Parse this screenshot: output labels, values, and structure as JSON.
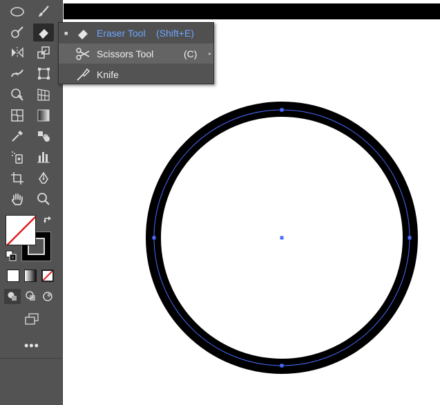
{
  "menu": {
    "items": [
      {
        "label": "Eraser Tool",
        "shortcut": "(Shift+E)",
        "icon": "eraser-icon",
        "selected": true
      },
      {
        "label": "Scissors Tool",
        "shortcut": "(C)",
        "icon": "scissors-icon"
      },
      {
        "label": "Knife",
        "shortcut": "",
        "icon": "knife-icon"
      }
    ]
  },
  "toolbar": {
    "tools": [
      "ellipse-icon",
      "paintbrush-icon",
      "shaper-icon",
      "eraser-icon",
      "reflect-icon",
      "scale-icon",
      "width-icon",
      "free-transform-icon",
      "shape-builder-icon",
      "perspective-grid-icon",
      "mesh-icon",
      "gradient-icon",
      "eyedropper-icon",
      "blend-icon",
      "symbol-sprayer-icon",
      "column-graph-icon",
      "artboard-icon",
      "pen-icon",
      "hand-icon",
      "zoom-icon"
    ],
    "more_label": "•••"
  },
  "colors": {
    "toolbar_bg": "#535353",
    "menu_highlight_text": "#6fa6ff",
    "selection_blue": "#4a6cff",
    "stroke": "#000000",
    "none_red": "#e01e1e"
  },
  "canvas": {
    "shape": "circle",
    "fill": "none",
    "stroke": "#000000",
    "selected": true
  }
}
